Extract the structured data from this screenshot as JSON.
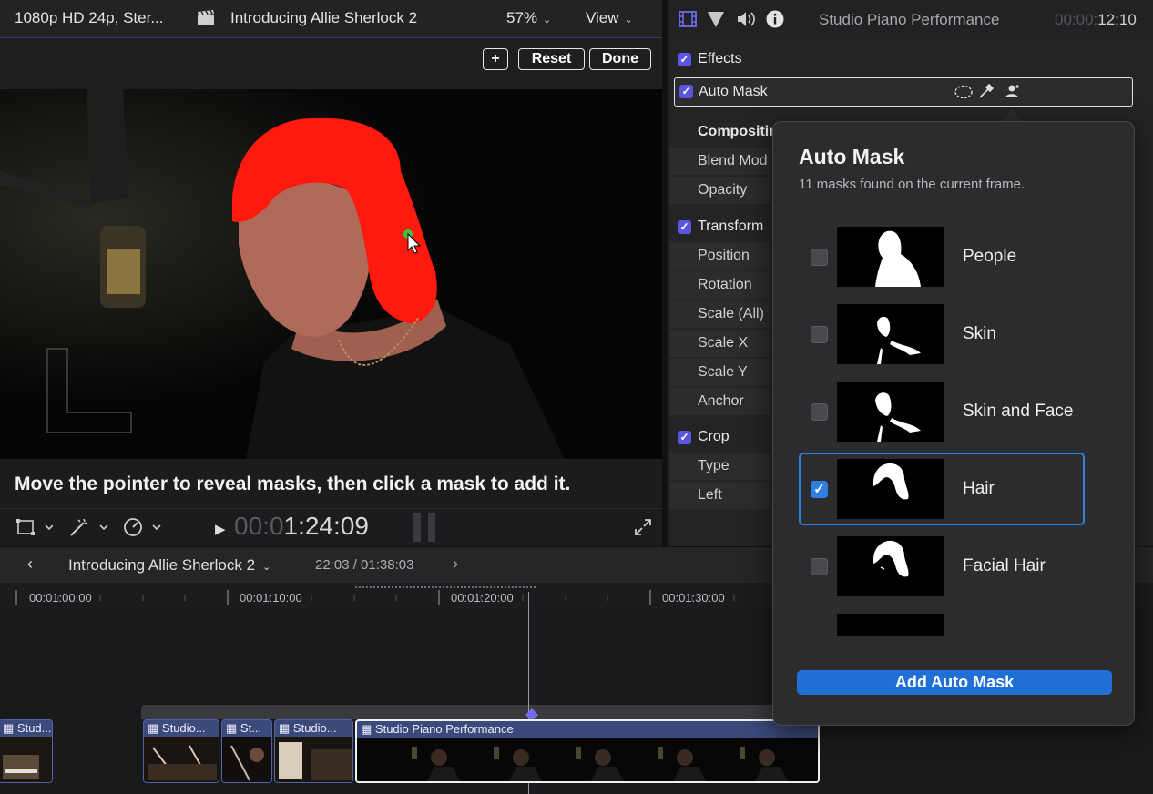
{
  "viewer": {
    "format": "1080p HD 24p, Ster...",
    "project_title": "Introducing Allie Sherlock 2",
    "zoom": "57%",
    "view_menu": "View",
    "add_label": "+",
    "reset_label": "Reset",
    "done_label": "Done",
    "instruction": "Move the pointer to reveal masks, then click a mask to add it.",
    "timecode_dim": "00:0",
    "timecode_bright": "1:24:09"
  },
  "inspector": {
    "clip_name": "Studio Piano Performance",
    "duration_dim": "00:00:",
    "duration_bright": "12:10",
    "effects_label": "Effects",
    "auto_mask_label": "Auto Mask",
    "compositing_label": "Compositin",
    "blend_label": "Blend Mod",
    "opacity_label": "Opacity",
    "transform_label": "Transform",
    "position_label": "Position",
    "rotation_label": "Rotation",
    "scale_all_label": "Scale (All)",
    "scale_x_label": "Scale X",
    "scale_y_label": "Scale Y",
    "anchor_label": "Anchor",
    "crop_label": "Crop",
    "type_label": "Type",
    "left_label": "Left"
  },
  "popover": {
    "title": "Auto Mask",
    "subtitle": "11 masks found on the current frame.",
    "masks": [
      {
        "label": "People",
        "checked": false
      },
      {
        "label": "Skin",
        "checked": false
      },
      {
        "label": "Skin and Face",
        "checked": false
      },
      {
        "label": "Hair",
        "checked": true
      },
      {
        "label": "Facial Hair",
        "checked": false
      }
    ],
    "add_button": "Add Auto Mask"
  },
  "timeline": {
    "project_name": "Introducing Allie Sherlock 2",
    "position": "22:03 / 01:38:03",
    "ruler": [
      "00:01:00:00",
      "00:01:10:00",
      "00:01:20:00",
      "00:01:30:00"
    ],
    "clips": [
      "Stud...",
      "Studio...",
      "St...",
      "Studio...",
      "Studio Piano Performance"
    ]
  },
  "colors": {
    "accent": "#5a56e0",
    "select_blue": "#2f7fe0",
    "mask_red": "#ff1a10"
  }
}
